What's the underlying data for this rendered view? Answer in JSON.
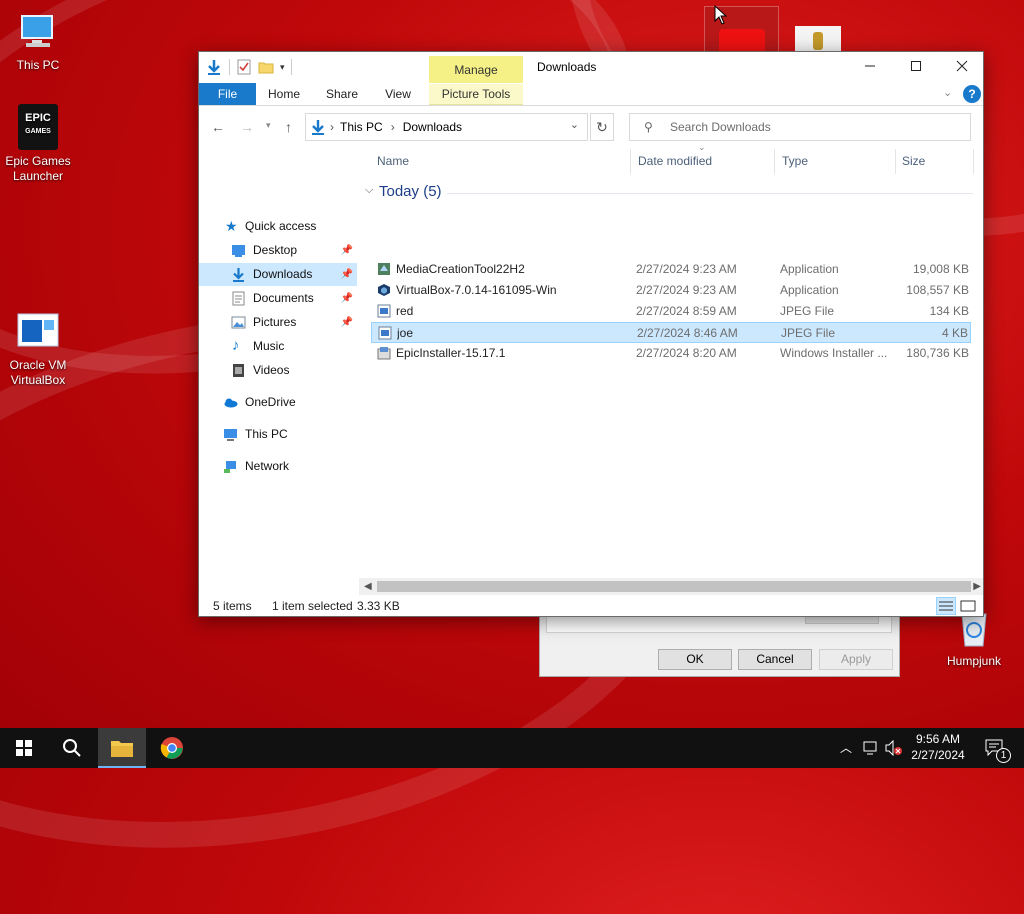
{
  "desktop": {
    "icons": [
      {
        "label": "This PC"
      },
      {
        "label": "Epic Games Launcher",
        "logo_top": "EPIC",
        "logo_bottom": "GAMES"
      },
      {
        "label": "Oracle VM VirtualBox"
      },
      {
        "label": "Humpjunk"
      }
    ]
  },
  "dialog_behind": {
    "ok_label": "OK",
    "cancel_label": "Cancel",
    "apply_label": "Apply"
  },
  "window": {
    "title": "Downloads",
    "manage_tab": "Manage",
    "picture_tools": "Picture Tools",
    "ribbon_tabs": [
      "File",
      "Home",
      "Share",
      "View"
    ],
    "address": {
      "segments": [
        "This PC",
        "Downloads"
      ]
    },
    "search_placeholder": "Search Downloads",
    "nav": {
      "quick_access": "Quick access",
      "items": [
        "Desktop",
        "Downloads",
        "Documents",
        "Pictures",
        "Music",
        "Videos"
      ],
      "onedrive": "OneDrive",
      "thispc": "This PC",
      "network": "Network"
    },
    "columns": {
      "name": "Name",
      "date": "Date modified",
      "type": "Type",
      "size": "Size"
    },
    "group_label": "Today (5)",
    "files": [
      {
        "name": "MediaCreationTool22H2",
        "date": "2/27/2024 9:23 AM",
        "type": "Application",
        "size": "19,008 KB"
      },
      {
        "name": "VirtualBox-7.0.14-161095-Win",
        "date": "2/27/2024 9:23 AM",
        "type": "Application",
        "size": "108,557 KB"
      },
      {
        "name": "red",
        "date": "2/27/2024 8:59 AM",
        "type": "JPEG File",
        "size": "134 KB"
      },
      {
        "name": "joe",
        "date": "2/27/2024 8:46 AM",
        "type": "JPEG File",
        "size": "4 KB"
      },
      {
        "name": "EpicInstaller-15.17.1",
        "date": "2/27/2024 8:20 AM",
        "type": "Windows Installer ...",
        "size": "180,736 KB"
      }
    ],
    "status": {
      "items": "5 items",
      "selected": "1 item selected",
      "size": "3.33 KB"
    }
  },
  "taskbar": {
    "time": "9:56 AM",
    "date": "2/27/2024",
    "notification_count": "1"
  },
  "colors": {
    "accent": "#1979ca",
    "selection": "#cce8ff",
    "manage": "#f5f187",
    "desktop_red": "#c0080a"
  }
}
